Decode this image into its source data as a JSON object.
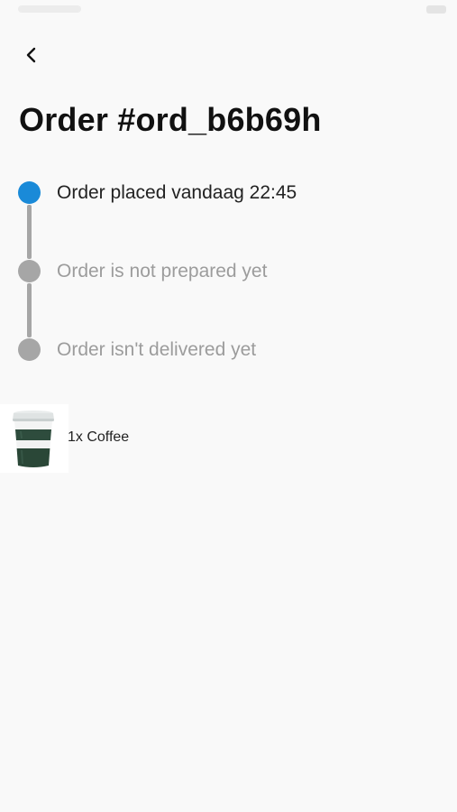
{
  "header": {
    "back_icon": "chevron-left-icon",
    "title": "Order #ord_b6b69h"
  },
  "timeline": {
    "steps": [
      {
        "label": "Order placed vandaag 22:45",
        "state": "active"
      },
      {
        "label": "Order is not prepared yet",
        "state": "pending"
      },
      {
        "label": "Order isn't delivered yet",
        "state": "pending"
      }
    ],
    "colors": {
      "active": "#1a8ad8",
      "pending": "#a6a6a6"
    }
  },
  "items": [
    {
      "label": "1x Coffee",
      "image": "coffee-cup-icon"
    }
  ]
}
